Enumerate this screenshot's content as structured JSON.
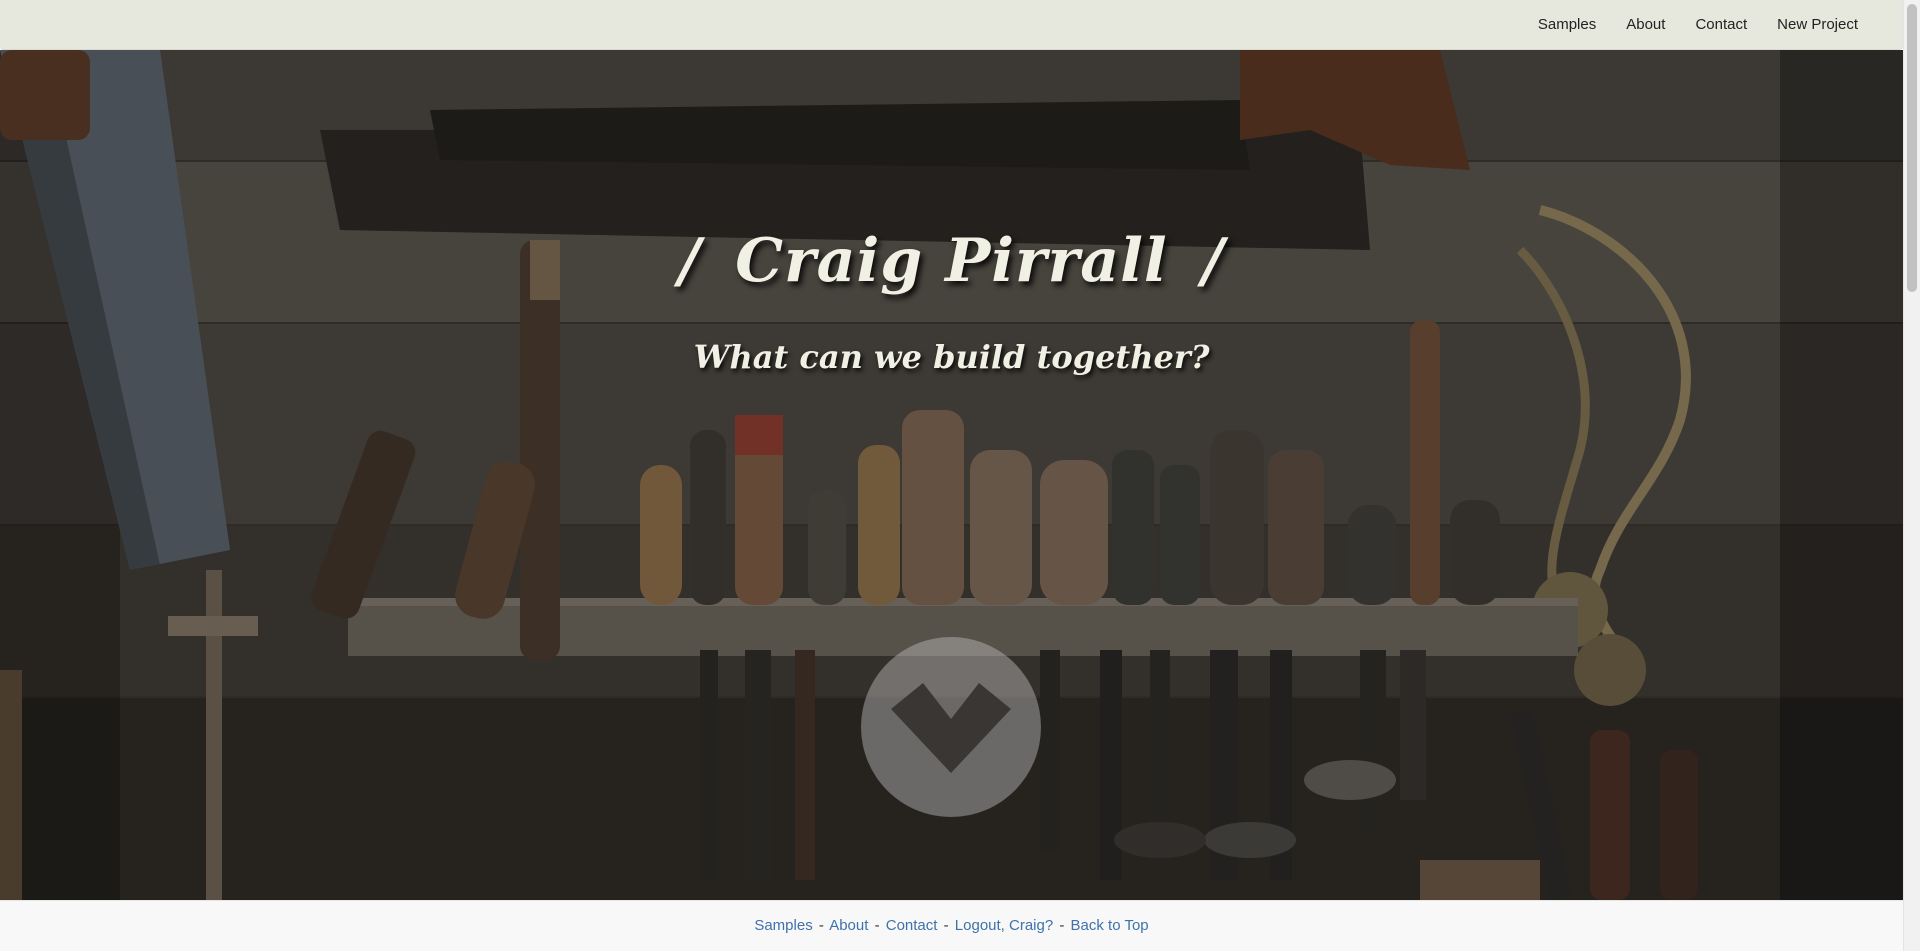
{
  "nav": {
    "items": [
      {
        "label": "Samples"
      },
      {
        "label": "About"
      },
      {
        "label": "Contact"
      },
      {
        "label": "New Project"
      }
    ]
  },
  "hero": {
    "bar_left": "/",
    "title": "Craig Pirrall",
    "bar_right": "/",
    "subtitle": "What can we build together?",
    "scroll_icon": "chevron-down-icon"
  },
  "footer": {
    "links": [
      {
        "label": "Samples"
      },
      {
        "label": "About"
      },
      {
        "label": "Contact"
      },
      {
        "label": "Logout, Craig?"
      },
      {
        "label": "Back to Top"
      }
    ],
    "separator": "-"
  },
  "colors": {
    "navbar_bg": "#e6e8de",
    "footer_link": "#3f72a9",
    "hero_text": "#f1f0e4"
  }
}
